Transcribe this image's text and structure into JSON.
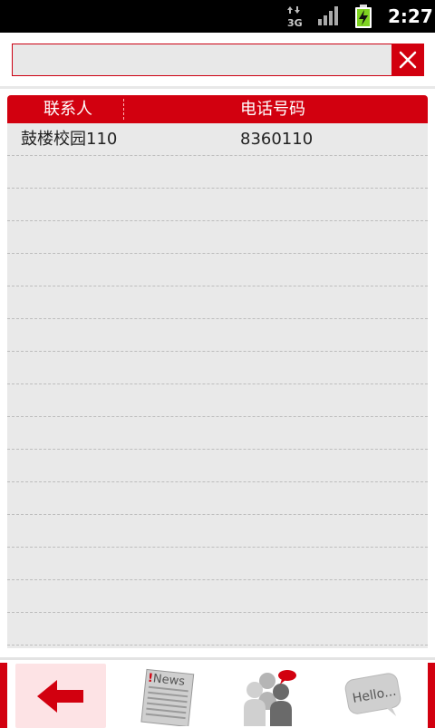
{
  "status_bar": {
    "network": "3G",
    "time": "2:27"
  },
  "search": {
    "value": "",
    "placeholder": ""
  },
  "table": {
    "headers": {
      "contact": "联系人",
      "phone": "电话号码"
    },
    "rows": [
      {
        "name": "鼓楼校园110",
        "phone": "8360110"
      }
    ]
  },
  "bottom_nav": {
    "news_label": "News",
    "hello_label": "Hello..."
  },
  "colors": {
    "accent": "#d2000f",
    "table_bg": "#e9e9e9",
    "selected_nav_bg": "#fde3e5"
  }
}
